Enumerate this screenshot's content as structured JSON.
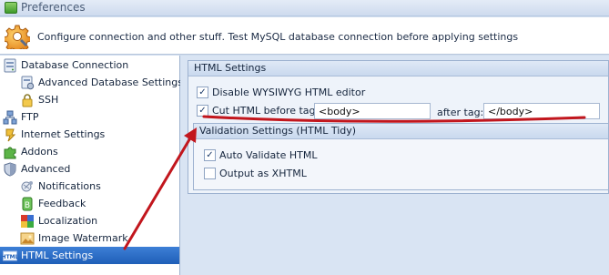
{
  "window": {
    "title": "Preferences"
  },
  "header": {
    "description": "Configure connection and other stuff. Test MySQL database connection before applying settings"
  },
  "sidebar": {
    "items": [
      {
        "label": "Database Connection",
        "icon": "database-icon",
        "level": 0
      },
      {
        "label": "Advanced Database Settings",
        "icon": "database-settings-icon",
        "level": 1
      },
      {
        "label": "SSH",
        "icon": "lock-icon",
        "level": 1
      },
      {
        "label": "FTP",
        "icon": "network-icon",
        "level": 0
      },
      {
        "label": "Internet Settings",
        "icon": "globe-icon",
        "level": 0
      },
      {
        "label": "Addons",
        "icon": "puzzle-icon",
        "level": 0
      },
      {
        "label": "Advanced",
        "icon": "shield-icon",
        "level": 0
      },
      {
        "label": "Notifications",
        "icon": "bell-icon",
        "level": 1
      },
      {
        "label": "Feedback",
        "icon": "feedback-icon",
        "level": 1
      },
      {
        "label": "Localization",
        "icon": "flag-icon",
        "level": 1
      },
      {
        "label": "Image Watermark",
        "icon": "image-icon",
        "level": 1
      },
      {
        "label": "HTML Settings",
        "icon": "html-icon",
        "level": 0,
        "selected": true
      }
    ]
  },
  "html_settings": {
    "title": "HTML Settings",
    "disable_wysiwyg": {
      "label": "Disable WYSIWYG HTML editor",
      "checked": true
    },
    "cut_html": {
      "label": "Cut HTML before tag:",
      "checked": true,
      "value": "<body>"
    },
    "after_tag": {
      "label": "after tag:",
      "value": "</body>"
    }
  },
  "validation": {
    "title": "Validation Settings (HTML Tidy)",
    "auto_validate": {
      "label": "Auto Validate HTML",
      "checked": true
    },
    "output_xhtml": {
      "label": "Output as XHTML",
      "checked": false
    }
  },
  "colors": {
    "annotation": "#c2161d",
    "selected": "#2a6cc7"
  }
}
